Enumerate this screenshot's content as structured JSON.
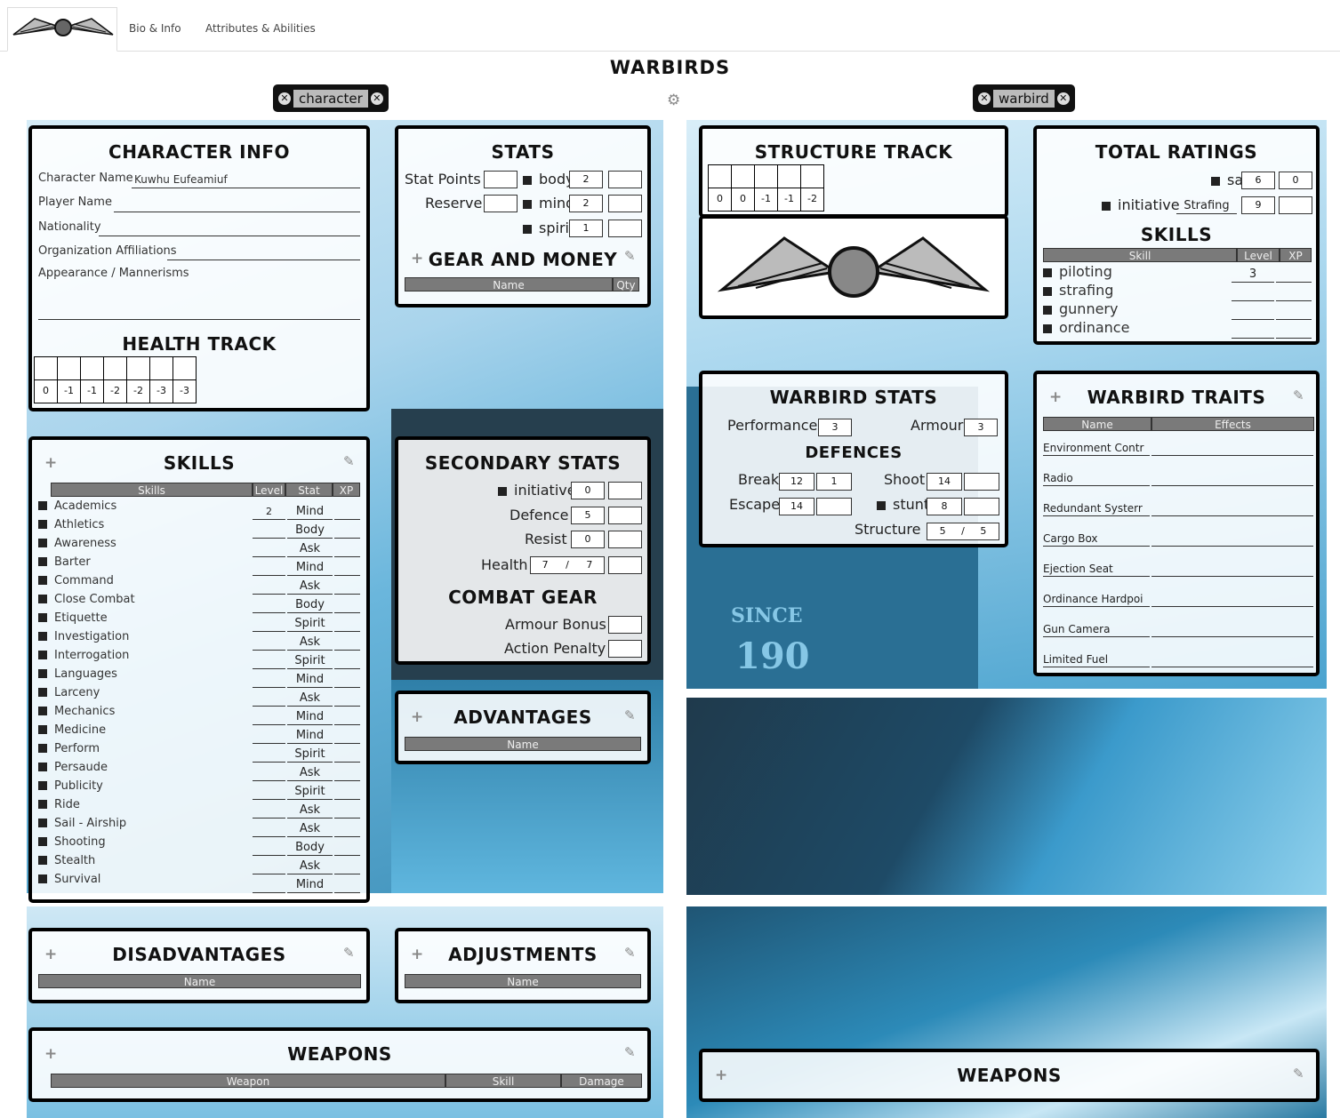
{
  "tabs": {
    "bio": "Bio & Info",
    "attributes": "Attributes & Abilities"
  },
  "title": "WARBIRDS",
  "selectors": {
    "character": "character",
    "warbird": "warbird"
  },
  "char_info": {
    "title": "CHARACTER INFO",
    "character_name_label": "Character Name",
    "character_name": "Kuwhu Eufeamiuf",
    "player_name_label": "Player Name",
    "nationality_label": "Nationality",
    "organization_label": "Organization Affiliations",
    "appearance_label": "Appearance / Mannerisms"
  },
  "health": {
    "title": "HEALTH TRACK",
    "values": [
      "0",
      "-1",
      "-1",
      "-2",
      "-2",
      "-3",
      "-3"
    ]
  },
  "stats": {
    "title": "STATS",
    "stat_points": "Stat Points",
    "reserve": "Reserve",
    "body": "body",
    "body_val": "2",
    "mind": "mind",
    "mind_val": "2",
    "spirit": "spirit",
    "spirit_val": "1"
  },
  "gear": {
    "title": "GEAR AND MONEY",
    "name": "Name",
    "qty": "Qty"
  },
  "skills": {
    "title": "SKILLS",
    "h_skills": "Skills",
    "h_level": "Level",
    "h_stat": "Stat",
    "h_xp": "XP",
    "rows": [
      {
        "name": "Academics",
        "level": "2",
        "stat": "Mind"
      },
      {
        "name": "Athletics",
        "level": "",
        "stat": "Body"
      },
      {
        "name": "Awareness",
        "level": "",
        "stat": "Ask"
      },
      {
        "name": "Barter",
        "level": "",
        "stat": "Mind"
      },
      {
        "name": "Command",
        "level": "",
        "stat": "Ask"
      },
      {
        "name": "Close Combat",
        "level": "",
        "stat": "Body"
      },
      {
        "name": "Etiquette",
        "level": "",
        "stat": "Spirit"
      },
      {
        "name": "Investigation",
        "level": "",
        "stat": "Ask"
      },
      {
        "name": "Interrogation",
        "level": "",
        "stat": "Spirit"
      },
      {
        "name": "Languages",
        "level": "",
        "stat": "Mind"
      },
      {
        "name": "Larceny",
        "level": "",
        "stat": "Ask"
      },
      {
        "name": "Mechanics",
        "level": "",
        "stat": "Mind"
      },
      {
        "name": "Medicine",
        "level": "",
        "stat": "Mind"
      },
      {
        "name": "Perform",
        "level": "",
        "stat": "Spirit"
      },
      {
        "name": "Persaude",
        "level": "",
        "stat": "Ask"
      },
      {
        "name": "Publicity",
        "level": "",
        "stat": "Spirit"
      },
      {
        "name": "Ride",
        "level": "",
        "stat": "Ask"
      },
      {
        "name": "Sail - Airship",
        "level": "",
        "stat": "Ask"
      },
      {
        "name": "Shooting",
        "level": "",
        "stat": "Body"
      },
      {
        "name": "Stealth",
        "level": "",
        "stat": "Ask"
      },
      {
        "name": "Survival",
        "level": "",
        "stat": "Mind"
      }
    ]
  },
  "secondary": {
    "title": "SECONDARY STATS",
    "initiative": "initiative",
    "initiative_val": "0",
    "defence": "Defence",
    "defence_val": "5",
    "resist": "Resist",
    "resist_val": "0",
    "health": "Health",
    "health_cur": "7",
    "slash": "/",
    "health_max": "7"
  },
  "combat": {
    "title": "COMBAT GEAR",
    "armour": "Armour Bonus",
    "penalty": "Action Penalty"
  },
  "advantages": {
    "title": "ADVANTAGES",
    "name": "Name"
  },
  "disadvantages": {
    "title": "DISADVANTAGES",
    "name": "Name"
  },
  "adjustments": {
    "title": "ADJUSTMENTS",
    "name": "Name"
  },
  "weapons": {
    "title": "WEAPONS",
    "weapon": "Weapon",
    "skill": "Skill",
    "damage": "Damage"
  },
  "structure": {
    "title": "STRUCTURE TRACK",
    "values": [
      "0",
      "0",
      "-1",
      "-1",
      "-2"
    ]
  },
  "ratings": {
    "title": "TOTAL RATINGS",
    "sa": "sa",
    "sa_val": "6",
    "sa_xp": "0",
    "initiative": "initiative",
    "initiative_skill": "Strafing",
    "initiative_val": "9"
  },
  "wskills": {
    "title": "SKILLS",
    "h_skill": "Skill",
    "h_level": "Level",
    "h_xp": "XP",
    "rows": [
      {
        "name": "piloting",
        "level": "3"
      },
      {
        "name": "strafing",
        "level": ""
      },
      {
        "name": "gunnery",
        "level": ""
      },
      {
        "name": "ordinance",
        "level": ""
      }
    ]
  },
  "wstats": {
    "title": "WARBIRD STATS",
    "performance": "Performance",
    "performance_val": "3",
    "armour": "Armour",
    "armour_val": "3",
    "defences": "DEFENCES",
    "break": "Break",
    "break_val": "12",
    "break_mod": "1",
    "shoot": "Shoot",
    "shoot_val": "14",
    "escape": "Escape",
    "escape_val": "14",
    "stunt": "stunt",
    "stunt_val": "8",
    "structure": "Structure",
    "structure_cur": "5",
    "structure_max": "5",
    "slash": "/"
  },
  "traits": {
    "title": "WARBIRD TRAITS",
    "h_name": "Name",
    "h_effects": "Effects",
    "rows": [
      "Environment Contr",
      "Radio",
      "Redundant Systerr",
      "Cargo Box",
      "Ejection Seat",
      "Ordinance Hardpoi",
      "Gun Camera",
      "Limited Fuel"
    ]
  },
  "wweapons": {
    "title": "WEAPONS"
  },
  "art_text": {
    "since": "SINCE",
    "year": "190"
  },
  "colors": {
    "accent": "#2a9fce",
    "dark": "#1e3a4a",
    "box_border": "#000000"
  }
}
